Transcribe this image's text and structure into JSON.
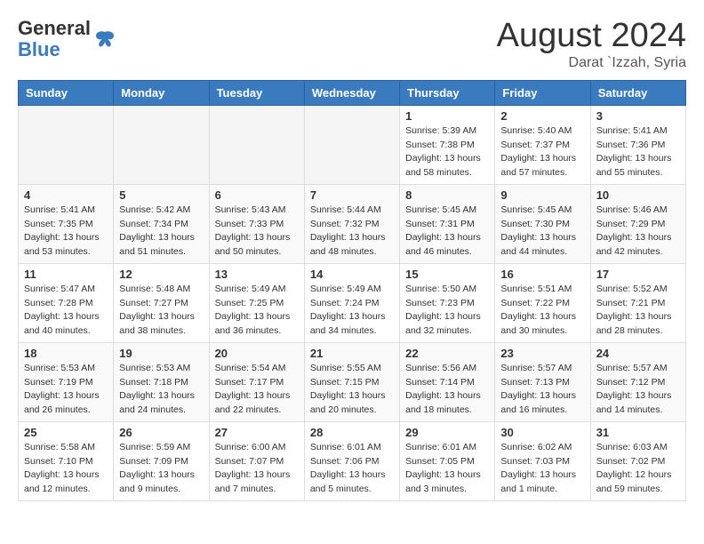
{
  "header": {
    "logo_general": "General",
    "logo_blue": "Blue",
    "month_year": "August 2024",
    "location": "Darat `Izzah, Syria"
  },
  "calendar": {
    "headers": [
      "Sunday",
      "Monday",
      "Tuesday",
      "Wednesday",
      "Thursday",
      "Friday",
      "Saturday"
    ],
    "weeks": [
      [
        {
          "day": "",
          "info": ""
        },
        {
          "day": "",
          "info": ""
        },
        {
          "day": "",
          "info": ""
        },
        {
          "day": "",
          "info": ""
        },
        {
          "day": "1",
          "info": "Sunrise: 5:39 AM\nSunset: 7:38 PM\nDaylight: 13 hours\nand 58 minutes."
        },
        {
          "day": "2",
          "info": "Sunrise: 5:40 AM\nSunset: 7:37 PM\nDaylight: 13 hours\nand 57 minutes."
        },
        {
          "day": "3",
          "info": "Sunrise: 5:41 AM\nSunset: 7:36 PM\nDaylight: 13 hours\nand 55 minutes."
        }
      ],
      [
        {
          "day": "4",
          "info": "Sunrise: 5:41 AM\nSunset: 7:35 PM\nDaylight: 13 hours\nand 53 minutes."
        },
        {
          "day": "5",
          "info": "Sunrise: 5:42 AM\nSunset: 7:34 PM\nDaylight: 13 hours\nand 51 minutes."
        },
        {
          "day": "6",
          "info": "Sunrise: 5:43 AM\nSunset: 7:33 PM\nDaylight: 13 hours\nand 50 minutes."
        },
        {
          "day": "7",
          "info": "Sunrise: 5:44 AM\nSunset: 7:32 PM\nDaylight: 13 hours\nand 48 minutes."
        },
        {
          "day": "8",
          "info": "Sunrise: 5:45 AM\nSunset: 7:31 PM\nDaylight: 13 hours\nand 46 minutes."
        },
        {
          "day": "9",
          "info": "Sunrise: 5:45 AM\nSunset: 7:30 PM\nDaylight: 13 hours\nand 44 minutes."
        },
        {
          "day": "10",
          "info": "Sunrise: 5:46 AM\nSunset: 7:29 PM\nDaylight: 13 hours\nand 42 minutes."
        }
      ],
      [
        {
          "day": "11",
          "info": "Sunrise: 5:47 AM\nSunset: 7:28 PM\nDaylight: 13 hours\nand 40 minutes."
        },
        {
          "day": "12",
          "info": "Sunrise: 5:48 AM\nSunset: 7:27 PM\nDaylight: 13 hours\nand 38 minutes."
        },
        {
          "day": "13",
          "info": "Sunrise: 5:49 AM\nSunset: 7:25 PM\nDaylight: 13 hours\nand 36 minutes."
        },
        {
          "day": "14",
          "info": "Sunrise: 5:49 AM\nSunset: 7:24 PM\nDaylight: 13 hours\nand 34 minutes."
        },
        {
          "day": "15",
          "info": "Sunrise: 5:50 AM\nSunset: 7:23 PM\nDaylight: 13 hours\nand 32 minutes."
        },
        {
          "day": "16",
          "info": "Sunrise: 5:51 AM\nSunset: 7:22 PM\nDaylight: 13 hours\nand 30 minutes."
        },
        {
          "day": "17",
          "info": "Sunrise: 5:52 AM\nSunset: 7:21 PM\nDaylight: 13 hours\nand 28 minutes."
        }
      ],
      [
        {
          "day": "18",
          "info": "Sunrise: 5:53 AM\nSunset: 7:19 PM\nDaylight: 13 hours\nand 26 minutes."
        },
        {
          "day": "19",
          "info": "Sunrise: 5:53 AM\nSunset: 7:18 PM\nDaylight: 13 hours\nand 24 minutes."
        },
        {
          "day": "20",
          "info": "Sunrise: 5:54 AM\nSunset: 7:17 PM\nDaylight: 13 hours\nand 22 minutes."
        },
        {
          "day": "21",
          "info": "Sunrise: 5:55 AM\nSunset: 7:15 PM\nDaylight: 13 hours\nand 20 minutes."
        },
        {
          "day": "22",
          "info": "Sunrise: 5:56 AM\nSunset: 7:14 PM\nDaylight: 13 hours\nand 18 minutes."
        },
        {
          "day": "23",
          "info": "Sunrise: 5:57 AM\nSunset: 7:13 PM\nDaylight: 13 hours\nand 16 minutes."
        },
        {
          "day": "24",
          "info": "Sunrise: 5:57 AM\nSunset: 7:12 PM\nDaylight: 13 hours\nand 14 minutes."
        }
      ],
      [
        {
          "day": "25",
          "info": "Sunrise: 5:58 AM\nSunset: 7:10 PM\nDaylight: 13 hours\nand 12 minutes."
        },
        {
          "day": "26",
          "info": "Sunrise: 5:59 AM\nSunset: 7:09 PM\nDaylight: 13 hours\nand 9 minutes."
        },
        {
          "day": "27",
          "info": "Sunrise: 6:00 AM\nSunset: 7:07 PM\nDaylight: 13 hours\nand 7 minutes."
        },
        {
          "day": "28",
          "info": "Sunrise: 6:01 AM\nSunset: 7:06 PM\nDaylight: 13 hours\nand 5 minutes."
        },
        {
          "day": "29",
          "info": "Sunrise: 6:01 AM\nSunset: 7:05 PM\nDaylight: 13 hours\nand 3 minutes."
        },
        {
          "day": "30",
          "info": "Sunrise: 6:02 AM\nSunset: 7:03 PM\nDaylight: 13 hours\nand 1 minute."
        },
        {
          "day": "31",
          "info": "Sunrise: 6:03 AM\nSunset: 7:02 PM\nDaylight: 12 hours\nand 59 minutes."
        }
      ]
    ]
  }
}
